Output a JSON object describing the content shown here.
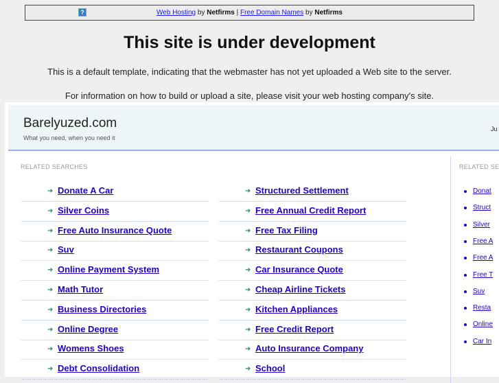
{
  "topbar": {
    "link1": "Web Hosting",
    "by1": " by ",
    "brand1": "Netfirms",
    "sep": " | ",
    "link2": "Free Domain Names",
    "by2": " by ",
    "brand2": "Netfirms",
    "help": "?"
  },
  "title": "This site is under development",
  "message1": "This is a default template, indicating that the webmaster has not yet uploaded a Web site to the server.",
  "message2": "For information on how to build or upload a site, please visit your web hosting company's site.",
  "site": {
    "name": "Barelyuzed.com",
    "tagline": "What you need, when you need it",
    "right_text": "Ju"
  },
  "related_label": "RELATED SEARCHES",
  "related_label_right": "RELATED SE",
  "left_col": [
    "Donate A Car",
    "Silver Coins",
    "Free Auto Insurance Quote",
    "Suv",
    "Online Payment System",
    "Math Tutor",
    "Business Directories",
    "Online Degree",
    "Womens Shoes",
    "Debt Consolidation"
  ],
  "mid_col": [
    "Structured Settlement",
    "Free Annual Credit Report",
    "Free Tax Filing",
    "Restaurant Coupons",
    "Car Insurance Quote",
    "Cheap Airline Tickets",
    "Kitchen Appliances",
    "Free Credit Report",
    "Auto Insurance Company",
    "School"
  ],
  "right_col": [
    "Donat",
    "Struct",
    "Silver",
    "Free A",
    "Free A",
    "Free T",
    "Suv",
    "Resta",
    "Online",
    "Car In"
  ]
}
